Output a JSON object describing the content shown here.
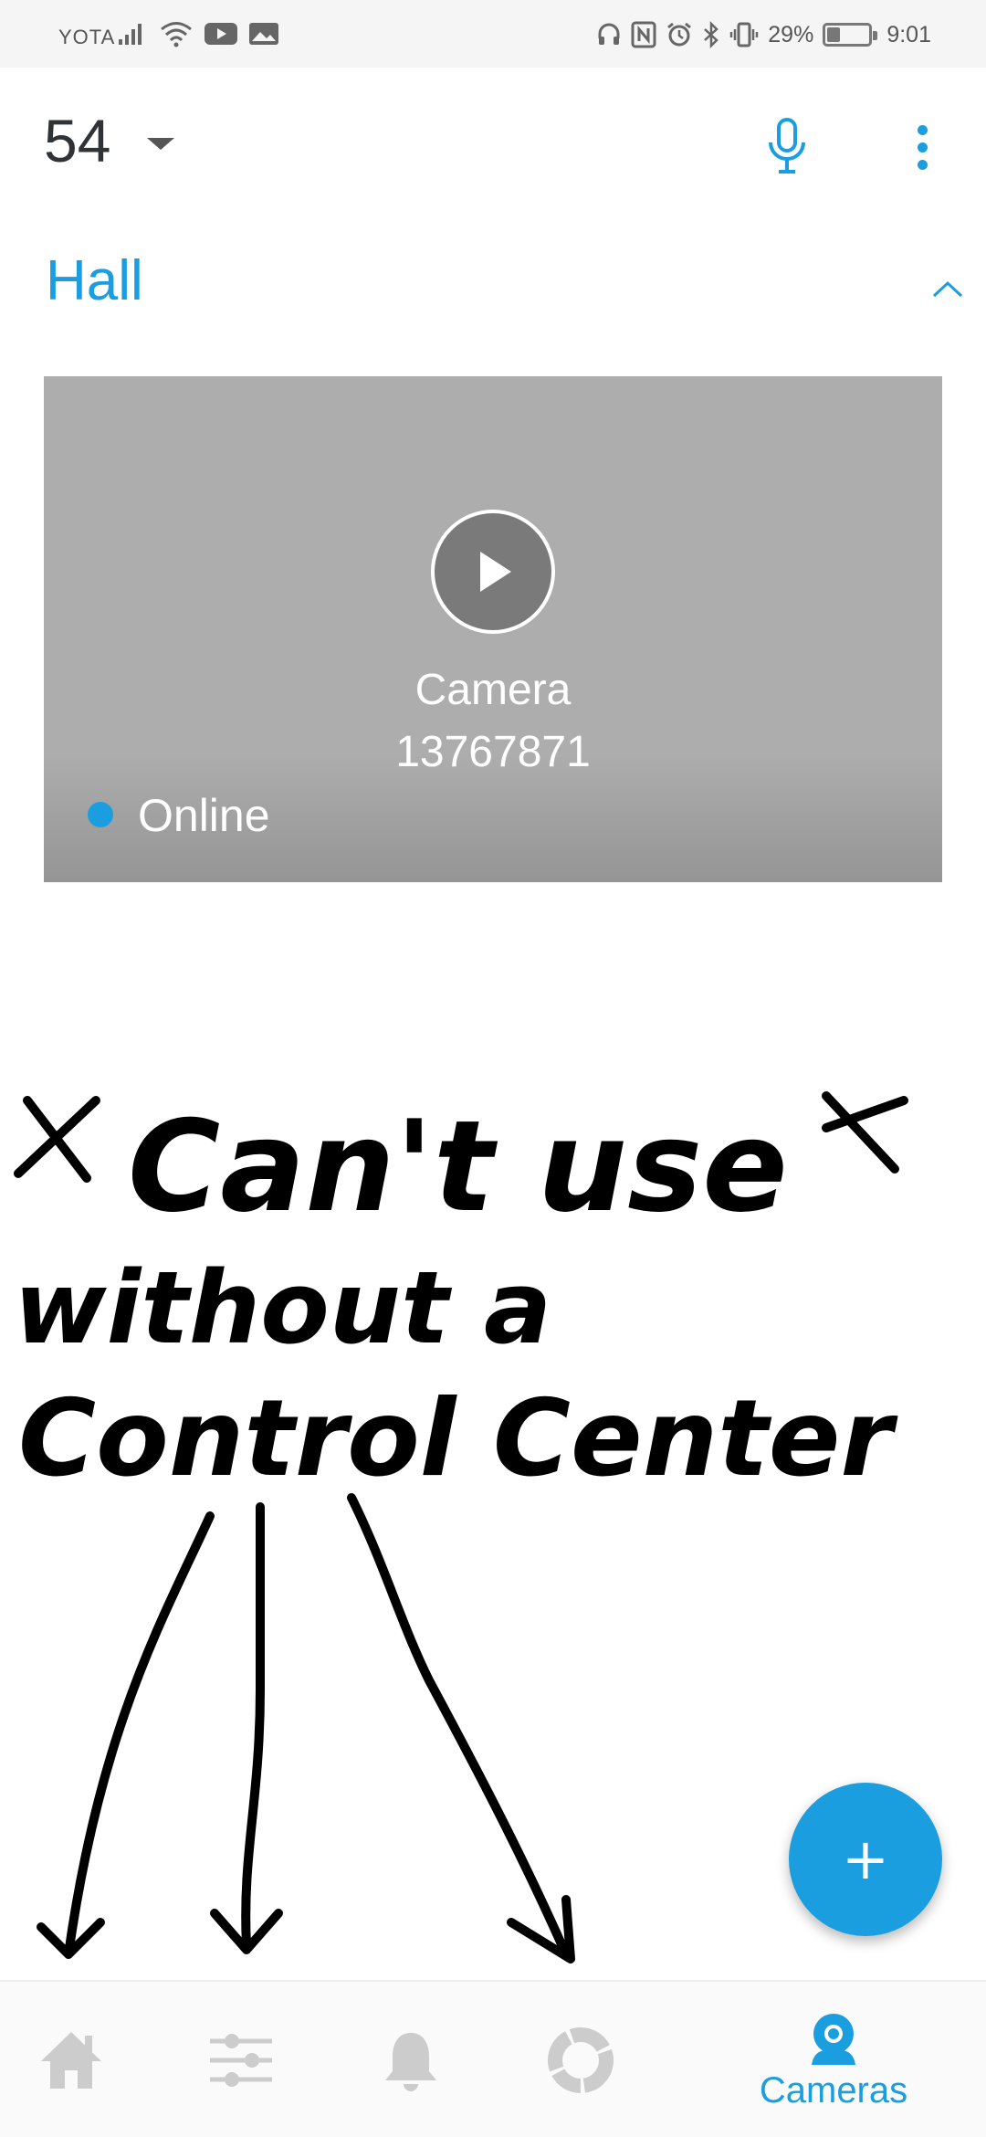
{
  "status_bar": {
    "carrier": "YOTA",
    "battery_percent_text": "29%",
    "battery_level": 0.29,
    "time": "9:01",
    "left_icons": [
      "signal-icon",
      "wifi-icon",
      "youtube-icon",
      "gallery-icon"
    ],
    "right_icons": [
      "headphones-icon",
      "nfc-icon",
      "alarm-icon",
      "bluetooth-icon",
      "vibrate-icon",
      "battery-icon"
    ]
  },
  "header": {
    "site_number": "54",
    "icons": [
      "chevron-down-icon",
      "microphone-icon",
      "more-vert-icon"
    ]
  },
  "group": {
    "title": "Hall",
    "icon": "chevron-up-icon"
  },
  "camera": {
    "name": "Camera",
    "id": "13767871",
    "status": "Online",
    "icon": "play-icon"
  },
  "annotation": {
    "line1": "Can't use",
    "line2": "without a",
    "line3": "Control Center"
  },
  "fab": {
    "label": "+",
    "icon": "add-icon"
  },
  "bottom_nav": {
    "items": [
      {
        "id": "home",
        "icon": "home-icon",
        "label": ""
      },
      {
        "id": "settings",
        "icon": "sliders-icon",
        "label": ""
      },
      {
        "id": "notifications",
        "icon": "bell-icon",
        "label": ""
      },
      {
        "id": "status",
        "icon": "donut-icon",
        "label": ""
      },
      {
        "id": "cameras",
        "icon": "camera-icon",
        "label": "Cameras",
        "active": true
      }
    ]
  },
  "colors": {
    "accent": "#1a9ee0",
    "card_background": "#adadad",
    "text_dark": "#2f3336",
    "nav_inactive": "#cccccc",
    "status_bar_bg": "#f5f5f5"
  }
}
